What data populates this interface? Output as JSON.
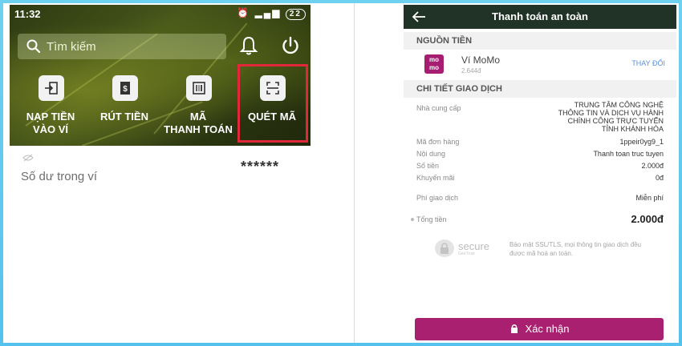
{
  "left": {
    "status": {
      "time": "11:32",
      "battery": "22"
    },
    "search": {
      "placeholder": "Tìm kiếm"
    },
    "actions": [
      {
        "label": "NẠP TIỀN\nVÀO VÍ",
        "icon": "deposit-icon"
      },
      {
        "label": "RÚT TIỀN",
        "icon": "withdraw-icon"
      },
      {
        "label": "MÃ\nTHANH TOÁN",
        "icon": "barcode-icon"
      },
      {
        "label": "QUÉT MÃ",
        "icon": "scan-icon"
      }
    ],
    "balance": {
      "label": "Số dư trong ví",
      "value": "******"
    }
  },
  "right": {
    "header": {
      "title": "Thanh toán an toàn"
    },
    "source": {
      "section_title": "NGUỒN TIỀN",
      "wallet_name": "Ví MoMo",
      "wallet_sub": "2.644đ",
      "change_label": "THAY ĐỔI",
      "logo_text": "mo\nmo"
    },
    "details": {
      "section_title": "CHI TIẾT GIAO DỊCH",
      "rows": [
        {
          "label": "Nhà cung cấp",
          "value": "TRUNG TÂM CÔNG NGHỆ\nTHÔNG TIN VÀ DỊCH VỤ HÀNH\nCHÍNH CÔNG TRỰC TUYẾN\nTỈNH KHÁNH HÒA"
        },
        {
          "label": "Mã đơn hàng",
          "value": "1ppeir0yg9_1"
        },
        {
          "label": "Nội dung",
          "value": "Thanh toan truc tuyen"
        },
        {
          "label": "Số tiền",
          "value": "2.000đ"
        },
        {
          "label": "Khuyến mãi",
          "value": "0đ"
        },
        {
          "label": "Phí giao dịch",
          "value": "Miễn phí"
        }
      ],
      "total_label": "Tổng tiền",
      "total_value": "2.000đ"
    },
    "secure": {
      "badge_text": "secure",
      "badge_small": "GeoTrust",
      "note": "Bảo mật SSL/TLS, mọi thông tin giao dịch đều được mã hoá an toàn."
    },
    "confirm_label": "Xác nhận"
  },
  "colors": {
    "background": "#5cc7ee",
    "momo_brand": "#a8206f",
    "header_dark": "#213326",
    "highlight": "#e0283a",
    "link": "#5a8fd6"
  }
}
